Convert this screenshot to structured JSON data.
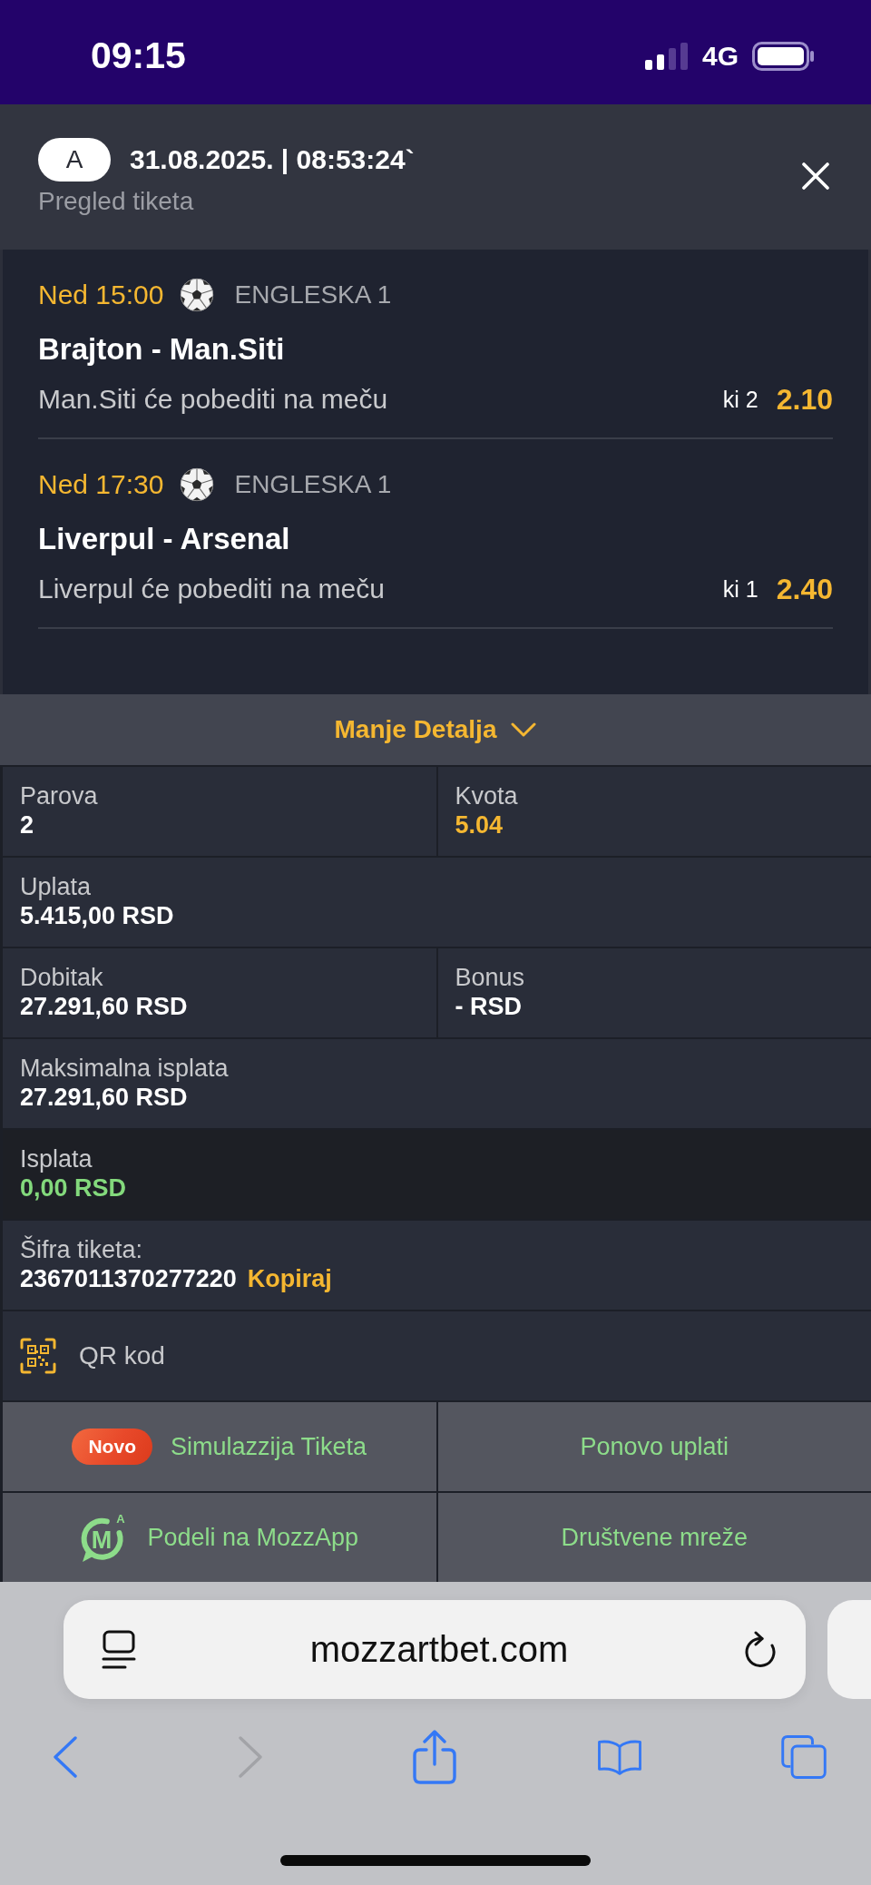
{
  "status_bar": {
    "time": "09:15",
    "network": "4G"
  },
  "header": {
    "badge": "A",
    "datetime": "31.08.2025. | 08:53:24`",
    "subtitle": "Pregled tiketa"
  },
  "matches": [
    {
      "time": "Ned 15:00",
      "league": "ENGLESKA 1",
      "teams": "Brajton - Man.Siti",
      "pick": "Man.Siti će pobediti na meču",
      "market": "ki 2",
      "odds": "2.10"
    },
    {
      "time": "Ned 17:30",
      "league": "ENGLESKA 1",
      "teams": "Liverpul - Arsenal",
      "pick": "Liverpul će pobediti na meču",
      "market": "ki 1",
      "odds": "2.40"
    }
  ],
  "details_toggle": {
    "label": "Manje Detalja",
    "expanded": true
  },
  "details": [
    {
      "highlighted": false,
      "cells": [
        {
          "label": "Parova",
          "value": "2",
          "kind": "count"
        },
        {
          "label": "Kvota",
          "value": "5.04",
          "kind": "odds"
        }
      ]
    },
    {
      "highlighted": false,
      "cells": [
        {
          "label": "Uplata",
          "value": "5.415,00 RSD",
          "kind": "amount"
        }
      ]
    },
    {
      "highlighted": false,
      "cells": [
        {
          "label": "Dobitak",
          "value": "27.291,60 RSD",
          "kind": "amount"
        },
        {
          "label": "Bonus",
          "value": "- RSD",
          "kind": "amount"
        }
      ]
    },
    {
      "highlighted": false,
      "cells": [
        {
          "label": "Maksimalna isplata",
          "value": "27.291,60 RSD",
          "kind": "amount"
        }
      ]
    },
    {
      "highlighted": true,
      "cells": [
        {
          "label": "Isplata",
          "value": "0,00 RSD",
          "kind": "payout"
        }
      ]
    }
  ],
  "ticket_code": {
    "label": "Šifra tiketa:",
    "code": "2367011370277220",
    "copy_link": "Kopiraj"
  },
  "qr": {
    "label": "QR kod"
  },
  "actions": [
    {
      "kind": "badge",
      "badge": "Novo",
      "label": "Simulazzija Tiketa"
    },
    {
      "kind": "plain",
      "label": "Ponovo uplati"
    },
    {
      "kind": "logo",
      "logo_letter": "M",
      "logo_mark": "A",
      "label": "Podeli na MozzApp"
    },
    {
      "kind": "plain",
      "label": "Društvene mreže"
    }
  ],
  "browser": {
    "url": "mozzartbet.com",
    "nav": [
      {
        "kind": "back",
        "disabled": false
      },
      {
        "kind": "forward",
        "disabled": true
      },
      {
        "kind": "share",
        "disabled": false
      },
      {
        "kind": "bookmarks",
        "disabled": false
      },
      {
        "kind": "tabs",
        "disabled": false
      }
    ]
  }
}
